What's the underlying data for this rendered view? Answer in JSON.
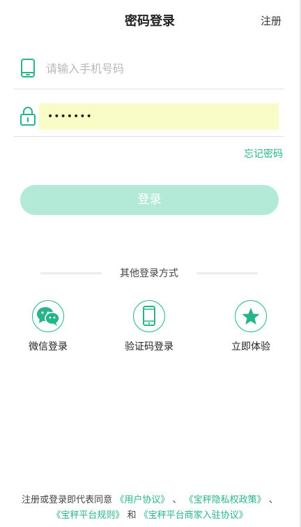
{
  "header": {
    "title": "密码登录",
    "register_label": "注册"
  },
  "form": {
    "phone_placeholder": "请输入手机号码",
    "phone_value": "",
    "password_value": "1234567",
    "forgot_label": "忘记密码",
    "login_label": "登录"
  },
  "other_login": {
    "divider_label": "其他登录方式",
    "options": [
      {
        "label": "微信登录",
        "icon": "wechat-icon"
      },
      {
        "label": "验证码登录",
        "icon": "mobile-phone-icon"
      },
      {
        "label": "立即体验",
        "icon": "star-icon"
      }
    ]
  },
  "agreement": {
    "prefix": "注册或登录即代表同意",
    "user_agreement": "《用户协议》",
    "sep1": "、",
    "privacy_policy": "《宝秤隐私权政策》",
    "sep2": "、",
    "platform_rules": "《宝秤平台规则》",
    "and": "和",
    "merchant_agreement": "《宝秤平台商家入驻协议》"
  },
  "colors": {
    "accent": "#27b48a",
    "button_disabled": "#b3ead7",
    "autofill_bg": "#fafcc8"
  }
}
